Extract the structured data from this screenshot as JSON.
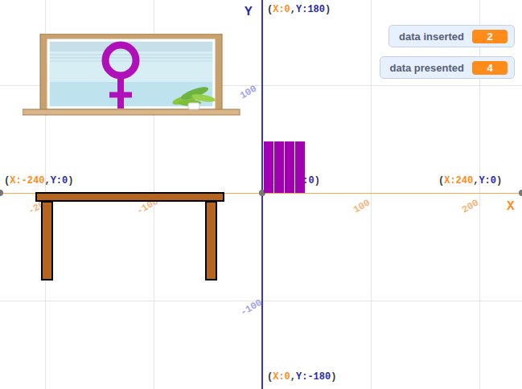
{
  "stage": {
    "axis_names": {
      "x": "X",
      "y": "Y"
    },
    "labels": {
      "left": [
        "(",
        "X:-240",
        ",",
        "Y:0",
        ")"
      ],
      "right": [
        "(",
        "X:240",
        ",",
        "Y:0",
        ")"
      ],
      "top": [
        "(",
        "X:0",
        ",",
        "Y:180",
        ")"
      ],
      "bottom": [
        "(",
        "X:0",
        ",",
        "Y:-180",
        ")"
      ],
      "origin": [
        "(",
        "X:0",
        ",",
        "Y:0",
        ")"
      ]
    },
    "x_ticks": [
      "-200",
      "-100",
      "100",
      "200"
    ],
    "y_ticks": [
      "100",
      "-100"
    ]
  },
  "monitors": [
    {
      "label": "data inserted",
      "value": "2"
    },
    {
      "label": "data presented",
      "value": "4"
    }
  ],
  "bars": {
    "values": [
      48,
      48,
      48,
      48
    ]
  }
}
